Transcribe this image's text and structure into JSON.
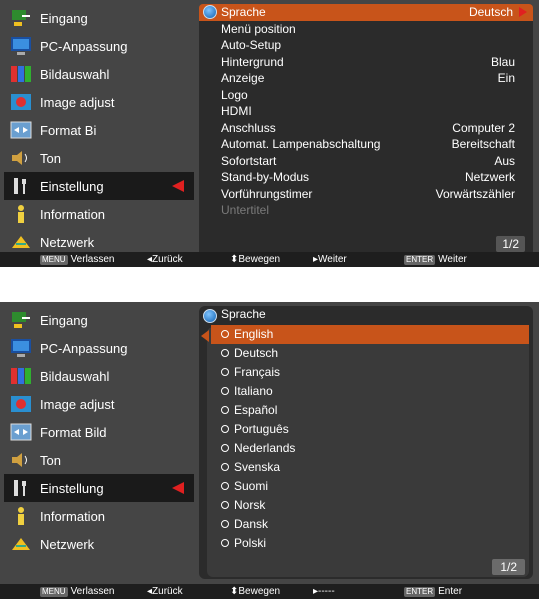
{
  "screen1": {
    "sidebar": [
      {
        "label": "Eingang",
        "icon": "input-icon"
      },
      {
        "label": "PC-Anpassung",
        "icon": "pc-adjust-icon"
      },
      {
        "label": "Bildauswahl",
        "icon": "image-select-icon"
      },
      {
        "label": "Image adjust",
        "icon": "image-adjust-icon"
      },
      {
        "label": "Format Bi",
        "icon": "screen-format-icon"
      },
      {
        "label": "Ton",
        "icon": "sound-icon"
      },
      {
        "label": "Einstellung",
        "icon": "setting-icon",
        "selected": true
      },
      {
        "label": "Information",
        "icon": "information-icon"
      },
      {
        "label": "Netzwerk",
        "icon": "network-icon"
      }
    ],
    "menu": [
      {
        "label": "Sprache",
        "value": "Deutsch",
        "head": true
      },
      {
        "label": "Menü position",
        "value": ""
      },
      {
        "label": "Auto-Setup",
        "value": ""
      },
      {
        "label": "Hintergrund",
        "value": "Blau"
      },
      {
        "label": "Anzeige",
        "value": "Ein"
      },
      {
        "label": "Logo",
        "value": ""
      },
      {
        "label": "HDMI",
        "value": ""
      },
      {
        "label": "Anschluss",
        "value": "Computer 2"
      },
      {
        "label": "Automat. Lampenabschaltung",
        "value": "Bereitschaft"
      },
      {
        "label": "Sofortstart",
        "value": "Aus"
      },
      {
        "label": "Stand-by-Modus",
        "value": "Netzwerk"
      },
      {
        "label": "Vorführungstimer",
        "value": "Vorwärtszähler"
      },
      {
        "label": "Untertitel",
        "value": "",
        "dim": true
      }
    ],
    "page_indicator": "1/2",
    "bottombar": {
      "menu_key": "MENU",
      "menu_label": "Verlassen",
      "back": "◂Zurück",
      "move": "⬍Bewegen",
      "next": "▸Weiter",
      "enter_key": "ENTER",
      "enter_label": "Weiter"
    }
  },
  "screen2": {
    "sidebar": [
      {
        "label": "Eingang",
        "icon": "input-icon"
      },
      {
        "label": "PC-Anpassung",
        "icon": "pc-adjust-icon"
      },
      {
        "label": "Bildauswahl",
        "icon": "image-select-icon"
      },
      {
        "label": "Image adjust",
        "icon": "image-adjust-icon"
      },
      {
        "label": "Format Bild",
        "icon": "screen-format-icon"
      },
      {
        "label": "Ton",
        "icon": "sound-icon"
      },
      {
        "label": "Einstellung",
        "icon": "setting-icon",
        "selected": true
      },
      {
        "label": "Information",
        "icon": "information-icon"
      },
      {
        "label": "Netzwerk",
        "icon": "network-icon"
      }
    ],
    "menu_title": "Sprache",
    "languages": [
      "English",
      "Deutsch",
      "Français",
      "Italiano",
      "Español",
      "Português",
      "Nederlands",
      "Svenska",
      "Suomi",
      "Norsk",
      "Dansk",
      "Polski"
    ],
    "selected_language": "English",
    "page_indicator": "1/2",
    "bottombar": {
      "menu_key": "MENU",
      "menu_label": "Verlassen",
      "back": "◂Zurück",
      "move": "⬍Bewegen",
      "next": "▸-----",
      "enter_key": "ENTER",
      "enter_label": "Enter"
    }
  },
  "colors": {
    "accent": "#c8541a",
    "panel": "#454545",
    "menu_bg": "#2b2b2b",
    "arrow_red": "#e02020"
  }
}
